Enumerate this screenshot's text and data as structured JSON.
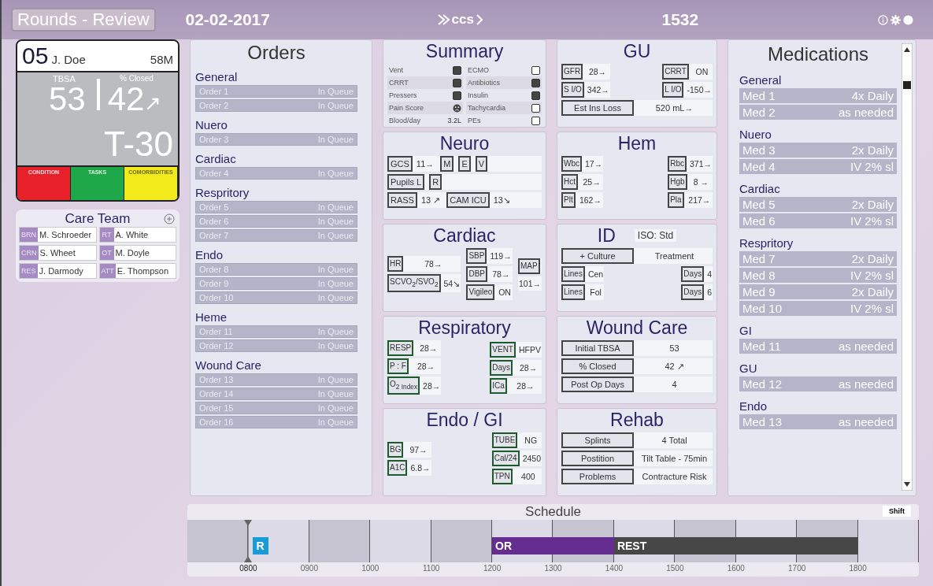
{
  "header": {
    "mode_button": "Rounds - Review",
    "date": "02-02-2017",
    "logo": "ccs",
    "unit": "1532"
  },
  "patient": {
    "bed": "05",
    "name": "J. Doe",
    "age_sex": "58M",
    "tbsa_label": "TBSA",
    "tbsa": "53",
    "closed_label": "% Closed",
    "closed": "42",
    "trend": "↗",
    "day": "T-30",
    "status_tabs": [
      {
        "label": "CONDITION",
        "color": "#e8202a"
      },
      {
        "label": "TASKS",
        "color": "#1fa84a"
      },
      {
        "label": "COMORBIDITIES",
        "color": "#f2ea1a"
      }
    ]
  },
  "care_team": {
    "title": "Care Team",
    "members": [
      {
        "role": "BRN",
        "name": "M. Schroeder"
      },
      {
        "role": "RT",
        "name": "A. White"
      },
      {
        "role": "CRN",
        "name": "S. Wheet"
      },
      {
        "role": "OT",
        "name": "M. Doyle"
      },
      {
        "role": "RES",
        "name": "J. Darmody"
      },
      {
        "role": "ATT",
        "name": "E. Thompson"
      }
    ]
  },
  "orders": {
    "title": "Orders",
    "groups": [
      {
        "name": "General",
        "orders": [
          {
            "name": "Order 1",
            "status": "In Queue"
          },
          {
            "name": "Order 2",
            "status": "In Queue"
          }
        ]
      },
      {
        "name": "Nuero",
        "orders": [
          {
            "name": "Order 3",
            "status": "In Queue"
          }
        ]
      },
      {
        "name": "Cardiac",
        "orders": [
          {
            "name": "Order 4",
            "status": "In Queue"
          }
        ]
      },
      {
        "name": "Respritory",
        "orders": [
          {
            "name": "Order 5",
            "status": "In Queue"
          },
          {
            "name": "Order 6",
            "status": "In Queue"
          },
          {
            "name": "Order 7",
            "status": "In Queue"
          }
        ]
      },
      {
        "name": "Endo",
        "orders": [
          {
            "name": "Order 8",
            "status": "In Queue"
          },
          {
            "name": "Order 9",
            "status": "In Queue"
          },
          {
            "name": "Order 10",
            "status": "In Queue"
          }
        ]
      },
      {
        "name": "Heme",
        "orders": [
          {
            "name": "Order 11",
            "status": "In Queue"
          },
          {
            "name": "Order 12",
            "status": "In Queue"
          }
        ]
      },
      {
        "name": "Wound Care",
        "orders": [
          {
            "name": "Order 13",
            "status": "In Queue"
          },
          {
            "name": "Order 14",
            "status": "In Queue"
          },
          {
            "name": "Order 15",
            "status": "In Queue"
          },
          {
            "name": "Order 16",
            "status": "In Queue"
          }
        ]
      }
    ]
  },
  "summary": {
    "title": "Summary",
    "items": [
      {
        "label": "Vent",
        "kind": "toggle",
        "on": true
      },
      {
        "label": "ECMO",
        "kind": "toggle",
        "on": false
      },
      {
        "label": "CRRT",
        "kind": "toggle",
        "on": true
      },
      {
        "label": "Antibiotics",
        "kind": "toggle",
        "on": true
      },
      {
        "label": "Pressers",
        "kind": "toggle",
        "on": true
      },
      {
        "label": "Insulin",
        "kind": "toggle",
        "on": true
      },
      {
        "label": "Pain Score",
        "kind": "face"
      },
      {
        "label": "Tachycardia",
        "kind": "toggle",
        "on": false
      },
      {
        "label": "Blood/day",
        "kind": "reading",
        "value": "3.2L"
      },
      {
        "label": "PEs",
        "kind": "toggle",
        "on": false
      }
    ]
  },
  "panels_column_1": [
    {
      "title": "Neuro",
      "color": "#444444",
      "sections": [
        {
          "kind": "line",
          "fields": [
            {
              "label": "GCS",
              "value": "11→"
            },
            {
              "label": "M"
            },
            {
              "label": "E"
            },
            {
              "label": "V"
            }
          ]
        },
        {
          "kind": "line",
          "fields": [
            {
              "label": "Pupils  L"
            },
            {
              "label": "R"
            }
          ]
        },
        {
          "kind": "line",
          "fields": [
            {
              "label": "RASS",
              "value": "13 ↗"
            },
            {
              "label": "CAM ICU",
              "value": "13↘"
            }
          ]
        }
      ]
    },
    {
      "title": "Cardiac",
      "color": "#444444",
      "sections": [
        {
          "kind": "columns",
          "columns": [
            [
              {
                "label": "HR",
                "value": "78→"
              },
              {
                "label": "SCVO$_{2}$/SVO$_{2}$",
                "value": "54↘"
              }
            ],
            [
              {
                "label": "SBP",
                "value": "119→"
              },
              {
                "label": "DBP",
                "value": "78→"
              },
              {
                "label": "Vigileo",
                "value": "ON"
              }
            ],
            [
              {
                "label": "MAP"
              },
              {
                "value": "101→"
              }
            ]
          ]
        }
      ]
    },
    {
      "title": "Respiratory",
      "color": "#1d5a2c",
      "sections": [
        {
          "kind": "columns",
          "columns": [
            [
              {
                "label": "RESP",
                "value": "28→"
              },
              {
                "label": "P : F",
                "value": "28→"
              },
              {
                "label": "O$_{2 Index}$",
                "value": "28→"
              }
            ],
            [
              {
                "label": "VENT",
                "value": "HFPV"
              },
              {
                "label": "Days",
                "value": "28→"
              },
              {
                "label": "ICa",
                "value": "28→"
              }
            ]
          ]
        }
      ]
    },
    {
      "title": "Endo / GI",
      "color": "#1d5a2c",
      "sections": [
        {
          "kind": "columns",
          "columns": [
            [
              {
                "label": "BG",
                "value": "97→"
              },
              {
                "label": "A1C",
                "value": "6.8→"
              }
            ],
            [
              {
                "label": "TUBE",
                "value": "NG"
              },
              {
                "label": "Cal/24",
                "value": "2450"
              },
              {
                "label": "TPN",
                "value": "400"
              }
            ]
          ]
        }
      ]
    }
  ],
  "panels_column_2": [
    {
      "title": "GU",
      "color": "#444444",
      "sections": [
        {
          "kind": "columns",
          "columns": [
            [
              {
                "label": "GFR",
                "value": "28→"
              },
              {
                "label": "S I/O",
                "value": "342→"
              }
            ],
            [
              {
                "label": "CRRT",
                "value": "ON"
              },
              {
                "label": "L I/O",
                "value": "-150→"
              }
            ]
          ]
        },
        {
          "kind": "rows",
          "fields": [
            {
              "label": "Est Ins Loss",
              "value": "520 mL→"
            }
          ]
        }
      ]
    },
    {
      "title": "Hem",
      "color": "#444444",
      "sections": [
        {
          "kind": "columns",
          "columns": [
            [
              {
                "label": "Wbc",
                "value": "17→"
              },
              {
                "label": "Hct",
                "value": "25→"
              },
              {
                "label": "Plt",
                "value": "162→"
              }
            ],
            [
              {
                "label": "Rbc",
                "value": "371→"
              },
              {
                "label": "Hgb",
                "value": "8 →"
              },
              {
                "label": "Pla",
                "value": "217→"
              }
            ]
          ]
        }
      ]
    },
    {
      "title": "ID",
      "tag": "ISO: Std",
      "color": "#444444",
      "sections": [
        {
          "kind": "rows",
          "fields": [
            {
              "label": "+ Culture",
              "value": "Treatment"
            }
          ]
        },
        {
          "kind": "columns",
          "columns": [
            [
              {
                "label": "Lines",
                "value": "Cen"
              },
              {
                "label": "Lines",
                "value": "Fol"
              }
            ],
            [
              {
                "label": "Days",
                "value": "4"
              },
              {
                "label": "Days",
                "value": "6"
              }
            ]
          ]
        }
      ]
    },
    {
      "title": "Wound Care",
      "color": "#444444",
      "sections": [
        {
          "kind": "rows",
          "fields": [
            {
              "label": "Initial TBSA",
              "value": "53"
            },
            {
              "label": "% Closed",
              "value": "42 ↗"
            },
            {
              "label": "Post Op Days",
              "value": "4"
            }
          ]
        }
      ]
    },
    {
      "title": "Rehab",
      "color": "#444444",
      "sections": [
        {
          "kind": "rows",
          "fields": [
            {
              "label": "Splints",
              "value": "4 Total"
            },
            {
              "label": "Postition",
              "value": "Tilt Table - 75min"
            },
            {
              "label": "Problems",
              "value": "Contracture Risk"
            }
          ]
        }
      ]
    }
  ],
  "medications": {
    "title": "Medications",
    "groups": [
      {
        "name": "General",
        "meds": [
          {
            "name": "Med 1",
            "dose": "4x Daily"
          },
          {
            "name": "Med 2",
            "dose": "as needed"
          }
        ]
      },
      {
        "name": "Nuero",
        "meds": [
          {
            "name": "Med 3",
            "dose": "2x Daily"
          },
          {
            "name": "Med 4",
            "dose": "IV 2% sl"
          }
        ]
      },
      {
        "name": "Cardiac",
        "meds": [
          {
            "name": "Med 5",
            "dose": "2x Daily"
          },
          {
            "name": "Med 6",
            "dose": "IV 2% sl"
          }
        ]
      },
      {
        "name": "Respritory",
        "meds": [
          {
            "name": "Med 7",
            "dose": "2x Daily"
          },
          {
            "name": "Med 8",
            "dose": "IV 2% sl"
          },
          {
            "name": "Med 9",
            "dose": "2x Daily"
          },
          {
            "name": "Med 10",
            "dose": "IV 2% sl"
          }
        ]
      },
      {
        "name": "GI",
        "meds": [
          {
            "name": "Med 11",
            "dose": "as needed"
          }
        ]
      },
      {
        "name": "GU",
        "meds": [
          {
            "name": "Med 12",
            "dose": "as needed"
          }
        ]
      },
      {
        "name": "Endo",
        "meds": [
          {
            "name": "Med 13",
            "dose": "as needed"
          }
        ]
      }
    ]
  },
  "schedule": {
    "title": "Schedule",
    "shift_button": "Shift",
    "hours": [
      {
        "label": "0800",
        "now": true,
        "events": [
          {
            "label": "R",
            "kind": "point",
            "color": "#1a9ad6"
          }
        ]
      },
      {
        "label": "0900",
        "now": false
      },
      {
        "label": "1000",
        "now": false
      },
      {
        "label": "1100",
        "now": false
      },
      {
        "label": "1200",
        "now": false,
        "events": [
          {
            "label": "OR",
            "kind": "block",
            "color": "#662d91"
          }
        ]
      },
      {
        "label": "1300",
        "now": false
      },
      {
        "label": "1400",
        "now": false,
        "events": [
          {
            "label": "REST",
            "kind": "block",
            "color": "#474747"
          }
        ]
      },
      {
        "label": "1500",
        "now": false
      },
      {
        "label": "1600",
        "now": false
      },
      {
        "label": "1700",
        "now": false
      },
      {
        "label": "1800",
        "now": false
      }
    ]
  }
}
